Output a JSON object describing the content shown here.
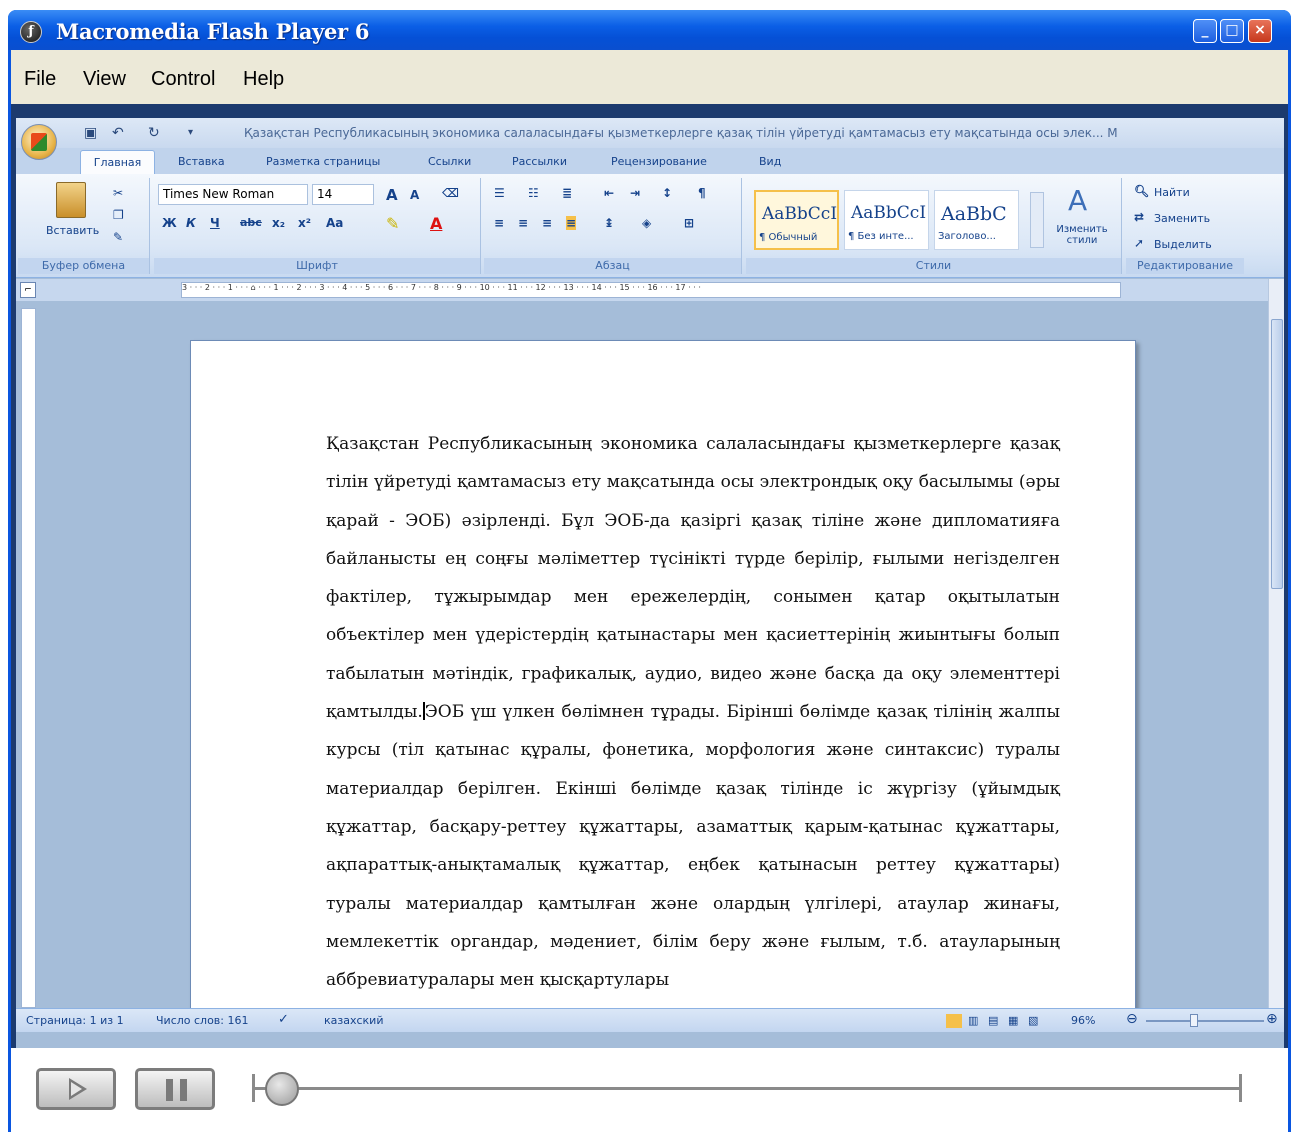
{
  "window": {
    "title": "Macromedia Flash Player 6",
    "buttons": {
      "minimize": "_",
      "maximize": "□",
      "close": "×"
    }
  },
  "menu": [
    {
      "label": "File"
    },
    {
      "label": "View"
    },
    {
      "label": "Control"
    },
    {
      "label": "Help"
    }
  ],
  "word": {
    "doc_title": "Қазақстан Республикасының экономика салаласындағы қызметкерлерге қазақ тілін үйретуді қамтамасыз ету мақсатында осы элек... M",
    "tabs": [
      "Главная",
      "Вставка",
      "Разметка страницы",
      "Ссылки",
      "Рассылки",
      "Рецензирование",
      "Вид"
    ],
    "clipboard": {
      "paste_label": "Вставить",
      "group_label": "Буфер обмена"
    },
    "font": {
      "name": "Times New Roman",
      "size": "14",
      "group_label": "Шрифт"
    },
    "paragraph": {
      "group_label": "Абзац"
    },
    "styles": {
      "items": [
        {
          "sample": "AaBbCcI",
          "name": "¶ Обычный"
        },
        {
          "sample": "AaBbCcI",
          "name": "¶ Без инте..."
        },
        {
          "sample": "AaBbC",
          "name": "Заголово..."
        }
      ],
      "change_label": "Изменить стили",
      "group_label": "Стили"
    },
    "editing": {
      "find": "Найти",
      "replace": "Заменить",
      "select": "Выделить",
      "group_label": "Редактирование"
    },
    "ruler_text": "3 · · · 2 · · · 1 · · · ⌂ · · · 1 · · · 2 · · · 3 · · · 4 · · · 5 · · · 6 · · · 7 · · · 8 · · · 9 · · · 10 · · · 11 · · · 12 · · · 13 · · · 14 · · · 15 · · · 16 · · · 17 · · ·",
    "document": {
      "text_before_caret": "Қазақстан Республикасының экономика салаласындағы қызметкерлерге қазақ тілін үйретуді қамтамасыз ету мақсатында осы электрондық оқу басылымы (әры қарай - ЭОБ) әзірленді. Бұл ЭОБ-да қазіргі қазақ тіліне және дипломатияға байланысты ең соңғы мәліметтер түсінікті түрде берілip, ғылыми негізделген фактілер, тұжырымдар мен ережелердің, сонымен қатар оқытылатын объектілер мен үдерістердің қатынастары мен қасиеттерінің жиынтығы болып табылатын мәтіндік, графикалық, аудио, видео және басқа да оқу элементтері қамтылды.",
      "text_after_caret": "ЭОБ үш үлкен бөлімнен тұрады.  Бірінші бөлімде қазақ тілінің жалпы курсы (тіл қатынас құралы, фонетика, морфология және синтаксис) туралы материалдар берілген. Екінші бөлімде қазақ тілінде іс жүргізу (ұйымдық құжаттар, басқару-реттеу құжаттары, азаматтық қарым-қатынас құжаттары, ақпараттық-анықтамалық құжаттар, еңбек қатынасын реттеу құжаттары) туралы материалдар қамтылған және олардың үлгілері, атаулар жинағы, мемлекеттік органдар, мәдениет, білім беру және ғылым, т.б. атауларының аббревиатуралары мен қысқартулары"
    },
    "status": {
      "page": "Страница: 1 из 1",
      "words": "Число слов: 161",
      "language": "казахский",
      "zoom": "96%"
    }
  },
  "player": {
    "progress": 0.0
  }
}
